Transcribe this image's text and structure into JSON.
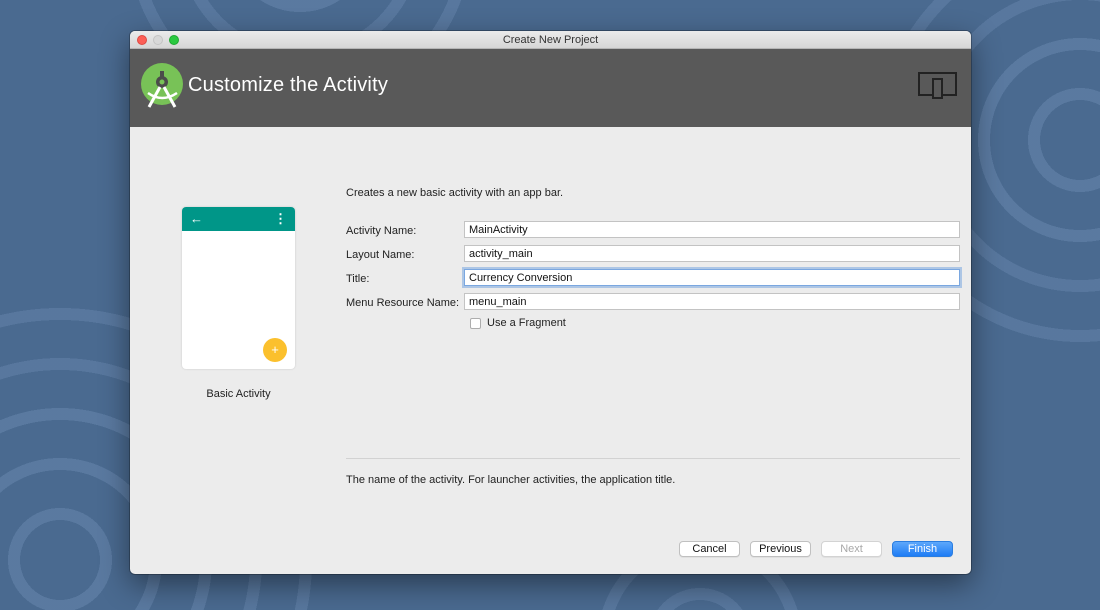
{
  "window": {
    "title": "Create New Project"
  },
  "header": {
    "title": "Customize the Activity",
    "logo_icon": "android-studio-logo-icon",
    "device_icon": "tablet-phone-icon"
  },
  "preview": {
    "label": "Basic Activity",
    "back_glyph": "←",
    "menu_glyph": "⋮",
    "fab_glyph": "+",
    "appbar_color": "#009688",
    "fab_color": "#fbc02d"
  },
  "description": "Creates a new basic activity with an app bar.",
  "form": {
    "fields": [
      {
        "label": "Activity Name:",
        "value": "MainActivity"
      },
      {
        "label": "Layout Name:",
        "value": "activity_main"
      },
      {
        "label": "Title:",
        "value": "Currency Conversion"
      },
      {
        "label": "Menu Resource Name:",
        "value": "menu_main"
      }
    ],
    "checkbox": {
      "label": "Use a Fragment",
      "checked": false
    }
  },
  "help_text": "The name of the activity. For launcher activities, the application title.",
  "buttons": {
    "cancel": "Cancel",
    "previous": "Previous",
    "next": "Next",
    "finish": "Finish"
  },
  "colors": {
    "accent": "#1e7cf5",
    "header_bg": "#595959"
  }
}
